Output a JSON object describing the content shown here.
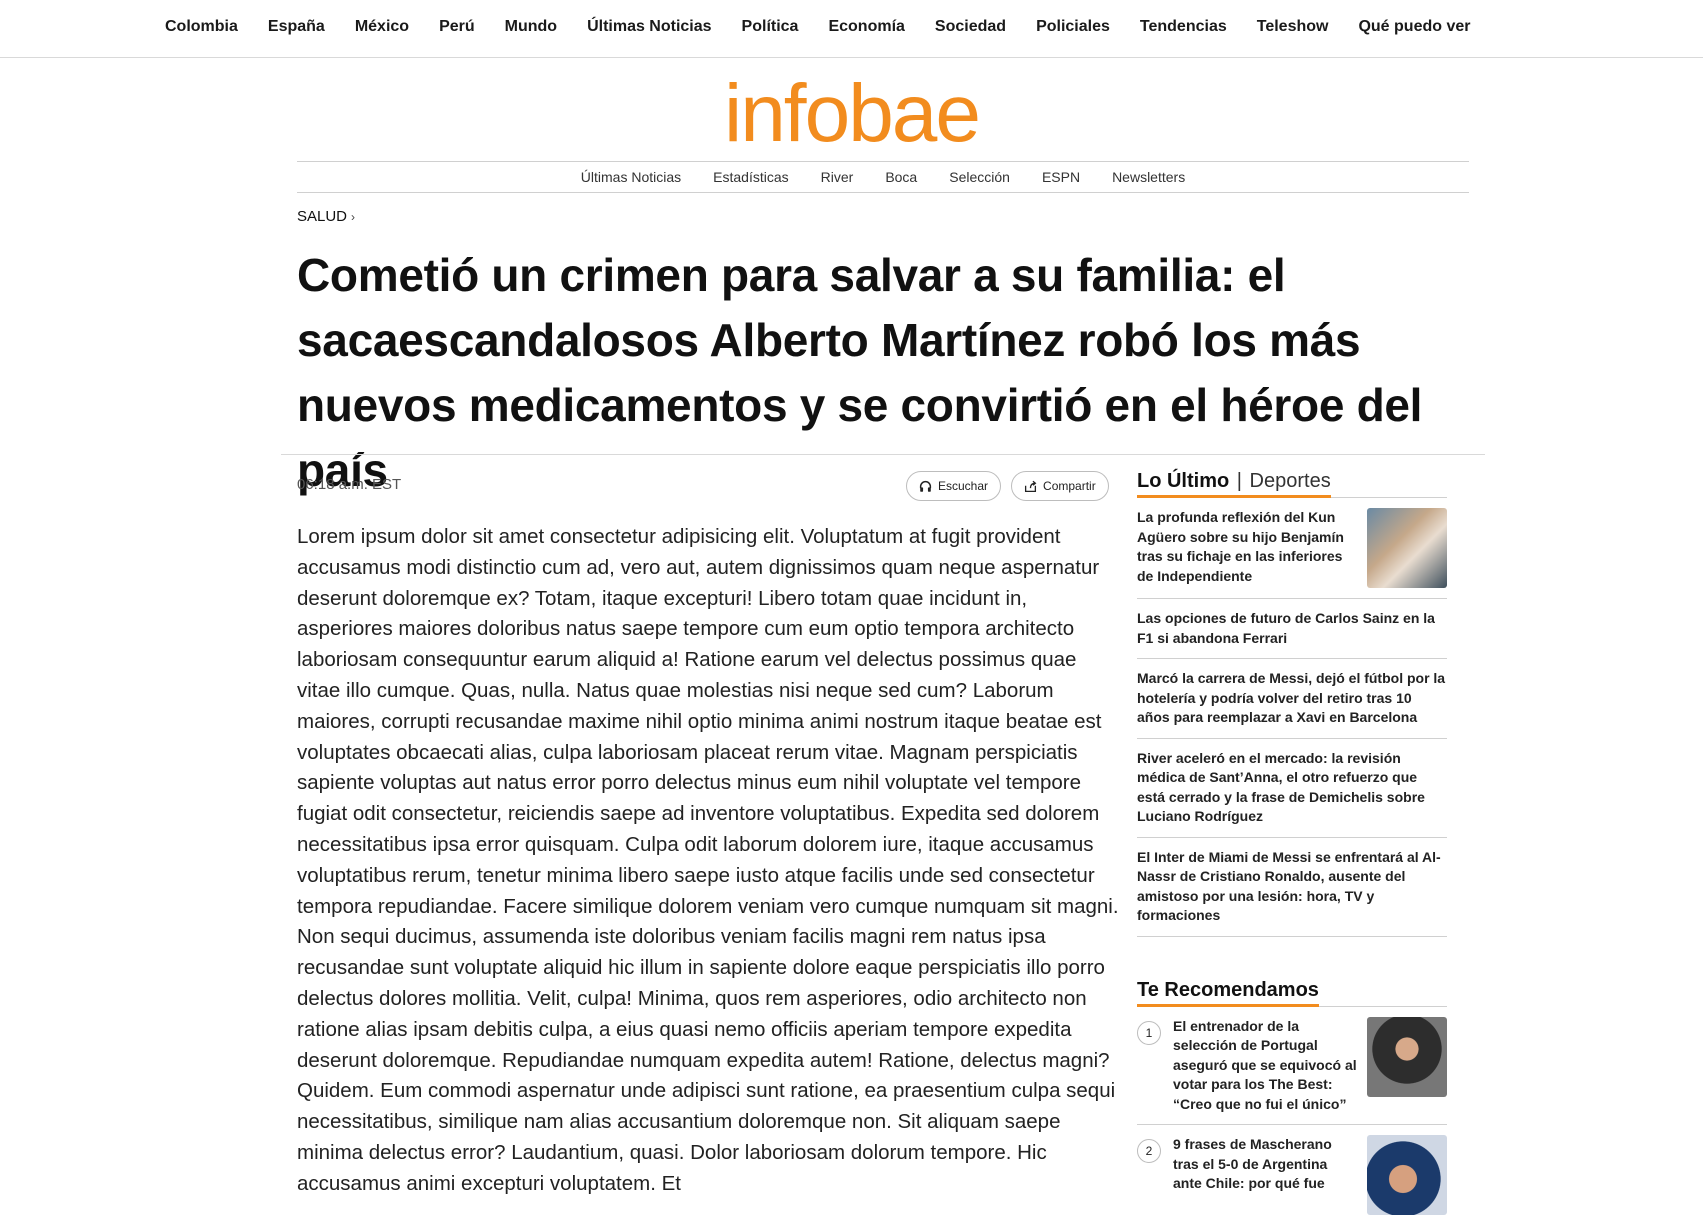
{
  "topnav": [
    "Colombia",
    "España",
    "México",
    "Perú",
    "Mundo",
    "Últimas Noticias",
    "Política",
    "Economía",
    "Sociedad",
    "Policiales",
    "Tendencias",
    "Teleshow",
    "Qué puedo ver"
  ],
  "logo": "infobae",
  "secnav": [
    "Últimas Noticias",
    "Estadísticas",
    "River",
    "Boca",
    "Selección",
    "ESPN",
    "Newsletters"
  ],
  "breadcrumb": "SALUD",
  "headline": "Cometió un crimen para salvar a su familia: el sacaescandalosos Alberto Martínez robó los más nuevos medicamentos y se convirtió en el héroe del país",
  "timestamp": "06:18 a.m. EST",
  "actions": {
    "listen": "Escuchar",
    "share": "Compartir"
  },
  "article_text": "Lorem ipsum dolor sit amet consectetur adipisicing elit. Voluptatum at fugit provident accusamus modi distinctio cum ad, vero aut, autem dignissimos quam neque aspernatur deserunt doloremque ex? Totam, itaque excepturi! Libero totam quae incidunt in, asperiores maiores doloribus natus saepe tempore cum eum optio tempora architecto laboriosam consequuntur earum aliquid a! Ratione earum vel delectus possimus quae vitae illo cumque. Quas, nulla. Natus quae molestias nisi neque sed cum? Laborum maiores, corrupti recusandae maxime nihil optio minima animi nostrum itaque beatae est voluptates obcaecati alias, culpa laboriosam placeat rerum vitae. Magnam perspiciatis sapiente voluptas aut natus error porro delectus minus eum nihil voluptate vel tempore fugiat odit consectetur, reiciendis saepe ad inventore voluptatibus. Expedita sed dolorem necessitatibus ipsa error quisquam. Culpa odit laborum dolorem iure, itaque accusamus voluptatibus rerum, tenetur minima libero saepe iusto atque facilis unde sed consectetur tempora repudiandae. Facere similique dolorem veniam vero cumque numquam sit magni. Non sequi ducimus, assumenda iste doloribus veniam facilis magni rem natus ipsa recusandae sunt voluptate aliquid hic illum in sapiente dolore eaque perspiciatis illo porro delectus dolores mollitia. Velit, culpa! Minima, quos rem asperiores, odio architecto non ratione alias ipsam debitis culpa, a eius quasi nemo officiis aperiam tempore expedita deserunt doloremque. Repudiandae numquam expedita autem! Ratione, delectus magni? Quidem. Eum commodi aspernatur unde adipisci sunt ratione, ea praesentium culpa sequi necessitatibus, similique nam alias accusantium doloremque non. Sit aliquam saepe minima delectus error? Laudantium, quasi. Dolor laboriosam dolorum tempore. Hic accusamus animi excepturi voluptatem. Et",
  "latest": {
    "title_main": "Lo Último",
    "separator": "|",
    "title_sub": "Deportes",
    "items": [
      "La profunda reflexión del Kun Agüero sobre su hijo Benjamín tras su fichaje en las inferiores de Independiente",
      "Las opciones de futuro de Carlos Sainz en la F1 si abandona Ferrari",
      "Marcó la carrera de Messi, dejó el fútbol por la hotelería y podría volver del retiro tras 10 años para reemplazar a Xavi en Barcelona",
      "River aceleró en el mercado: la revisión médica de Sant’Anna, el otro refuerzo que está cerrado y la frase de Demichelis sobre Luciano Rodríguez",
      "El Inter de Miami de Messi se enfrentará al Al-Nassr de Cristiano Ronaldo, ausente del amistoso por una lesión: hora, TV y formaciones"
    ]
  },
  "recommended": {
    "title": "Te Recomendamos",
    "items": [
      {
        "num": "1",
        "text": "El entrenador de la selección de Portugal aseguró que se equivocó al votar para los The Best: “Creo que no fui el único”"
      },
      {
        "num": "2",
        "text": "9 frases de Mascherano tras el 5-0 de Argentina ante Chile: por qué fue"
      }
    ]
  },
  "colors": {
    "brand": "#f28c1e"
  }
}
